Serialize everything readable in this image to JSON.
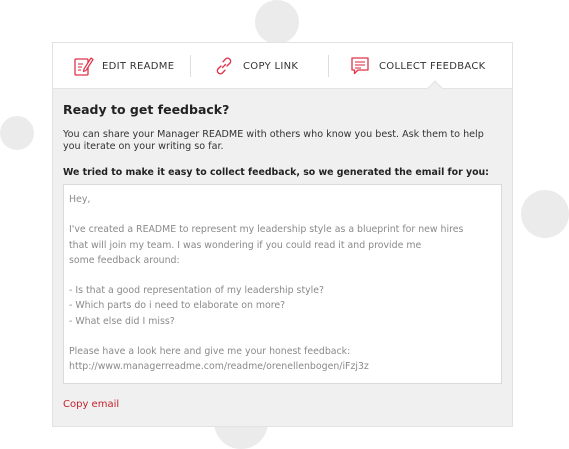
{
  "tabs": {
    "edit": {
      "label": "EDIT README",
      "icon": "edit-document-icon"
    },
    "copy": {
      "label": "COPY LINK",
      "icon": "link-icon"
    },
    "collect": {
      "label": "COLLECT FEEDBACK",
      "icon": "chat-bubble-icon"
    },
    "active": "collect"
  },
  "panel": {
    "title": "Ready to get feedback?",
    "description": "You can share your Manager README with others who know you best. Ask them to help you iterate on your writing so far.",
    "lead": "We tried to make it easy to collect feedback, so we generated the email for you:",
    "email_lines": [
      "Hey,",
      "",
      "I've created a README to represent my leadership style as a blueprint for new hires",
      "that will join my team. I was wondering if you could read it and provide me",
      "some feedback around:",
      "",
      "- Is that a good representation of my leadership style?",
      "- Which parts do i need to elaborate on more?",
      "- What else did I miss?",
      "",
      "Please have a look here and give me your honest feedback:",
      "http://www.managerreadme.com/readme/orenellenbogen/iFzj3z"
    ],
    "copy_email_label": "Copy email"
  },
  "colors": {
    "accent": "#c4232d",
    "icon_red": "#e0334a",
    "panel_bg": "#f0f0f0",
    "background_circles": "#ebebeb"
  }
}
